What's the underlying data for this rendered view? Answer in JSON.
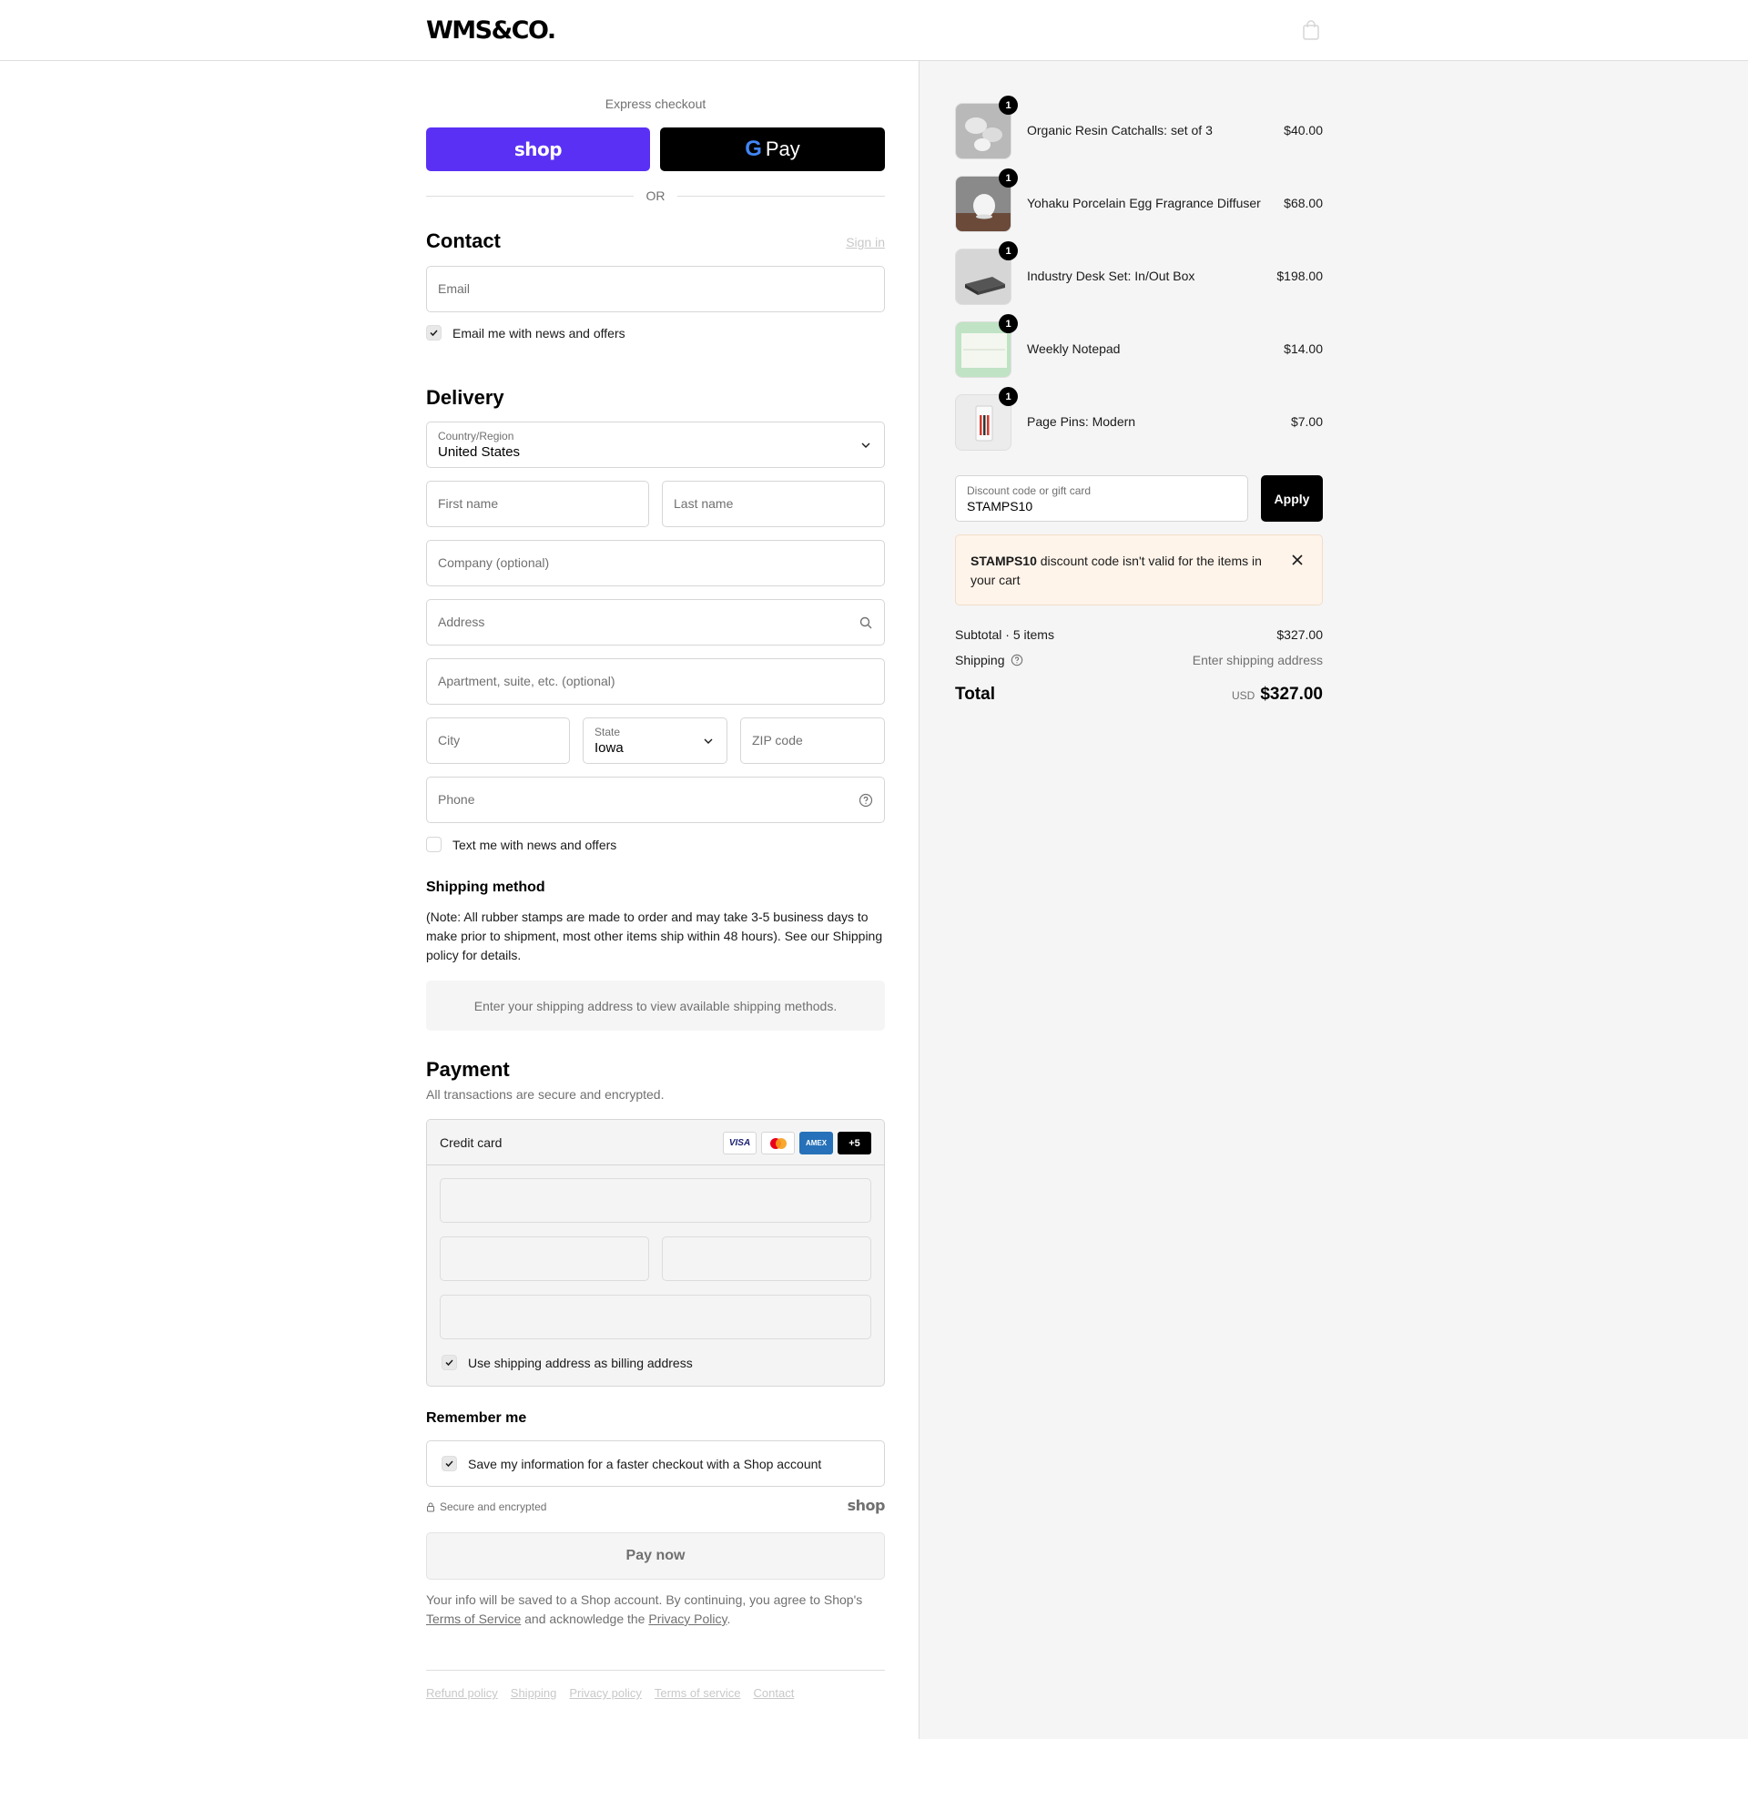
{
  "header": {
    "logo": "WMS&CO.",
    "cart_icon": "shopping-bag-icon"
  },
  "express": {
    "label": "Express checkout",
    "shop_label": "shop",
    "gpay_label": "Pay",
    "or": "OR"
  },
  "contact": {
    "title": "Contact",
    "sign_in": "Sign in",
    "email_placeholder": "Email",
    "news_label": "Email me with news and offers",
    "news_checked": true
  },
  "delivery": {
    "title": "Delivery",
    "country_label": "Country/Region",
    "country_value": "United States",
    "first_name_placeholder": "First name",
    "last_name_placeholder": "Last name",
    "company_placeholder": "Company (optional)",
    "address_placeholder": "Address",
    "apartment_placeholder": "Apartment, suite, etc. (optional)",
    "city_placeholder": "City",
    "state_label": "State",
    "state_value": "Iowa",
    "zip_placeholder": "ZIP code",
    "phone_placeholder": "Phone",
    "text_label": "Text me with news and offers",
    "text_checked": false
  },
  "shipping_method": {
    "title": "Shipping method",
    "note": "(Note: All rubber stamps are made to order and may take 3-5 business days to make prior to shipment, most other items ship within 48 hours). See our Shipping policy for details.",
    "empty": "Enter your shipping address to view available shipping methods."
  },
  "payment": {
    "title": "Payment",
    "subtitle": "All transactions are secure and encrypted.",
    "method": "Credit card",
    "card_logos": [
      "VISA",
      "mastercard",
      "AMEX",
      "+5"
    ],
    "billing_label": "Use shipping address as billing address",
    "billing_checked": true
  },
  "remember": {
    "title": "Remember me",
    "save_label": "Save my information for a faster checkout with a Shop account",
    "save_checked": true,
    "secure": "Secure and encrypted",
    "shop": "shop"
  },
  "pay_now": "Pay now",
  "legal": {
    "text1": "Your info will be saved to a Shop account. By continuing, you agree to Shop's ",
    "tos": "Terms of Service",
    "text2": " and acknowledge the ",
    "privacy": "Privacy Policy",
    "text3": "."
  },
  "footer_links": [
    "Refund policy",
    "Shipping",
    "Privacy policy",
    "Terms of service",
    "Contact"
  ],
  "cart": {
    "items": [
      {
        "name": "Organic Resin Catchalls: set of 3",
        "price": "$40.00",
        "qty": "1",
        "thumb_color": "#b9b9b9"
      },
      {
        "name": "Yohaku Porcelain Egg Fragrance Diffuser",
        "price": "$68.00",
        "qty": "1",
        "thumb_color": "#6b4a3a"
      },
      {
        "name": "Industry Desk Set: In/Out Box",
        "price": "$198.00",
        "qty": "1",
        "thumb_color": "#cfcfcf"
      },
      {
        "name": "Weekly Notepad",
        "price": "$14.00",
        "qty": "1",
        "thumb_color": "#bfe3c4"
      },
      {
        "name": "Page Pins: Modern",
        "price": "$7.00",
        "qty": "1",
        "thumb_color": "#ececec"
      }
    ],
    "discount_label": "Discount code or gift card",
    "discount_value": "STAMPS10",
    "apply": "Apply",
    "alert_code": "STAMPS10",
    "alert_text": " discount code isn't valid for the items in your cart",
    "subtotal_label": "Subtotal · 5 items",
    "subtotal_value": "$327.00",
    "shipping_label": "Shipping",
    "shipping_value": "Enter shipping address",
    "total_label": "Total",
    "total_currency": "USD",
    "total_value": "$327.00"
  },
  "colors": {
    "shop_purple": "#5a31f4",
    "alert_bg": "#fff4ea",
    "right_panel_bg": "#f5f5f5"
  }
}
